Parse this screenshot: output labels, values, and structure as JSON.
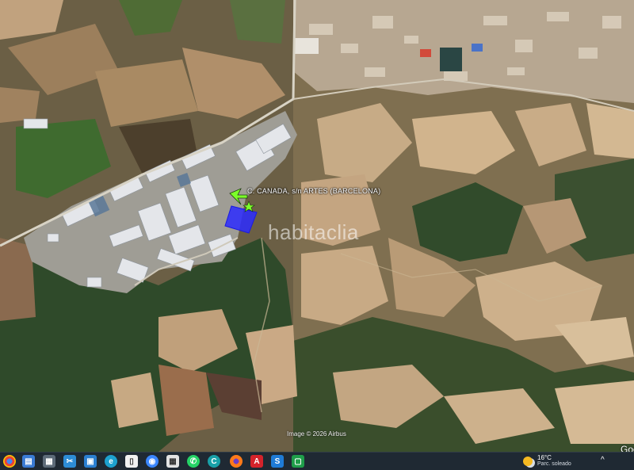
{
  "map": {
    "marker_label": "C. CANADA, s/n ARTES (BARCELONA)",
    "watermark": "habitaclia",
    "copyright": "Image © 2026 Airbus",
    "provider": "Goo"
  },
  "taskbar": {
    "icons": [
      "chrome-icon",
      "file-explorer-icon",
      "calculator-icon",
      "snipping-tool-icon",
      "edge-icon",
      "notepad-icon",
      "browser-icon",
      "screen-capture-icon",
      "whatsapp-icon",
      "chat-icon",
      "firefox-icon",
      "acrobat-icon",
      "app-s-icon",
      "app-window-icon"
    ],
    "weather": {
      "temperature": "16°C",
      "condition": "Parc. soleado"
    },
    "tray_chevron": "^"
  },
  "colors": {
    "parcel_fill": "#2b2bff",
    "marker_arrow": "#7cff2a",
    "taskbar_bg": "#1f2933"
  }
}
